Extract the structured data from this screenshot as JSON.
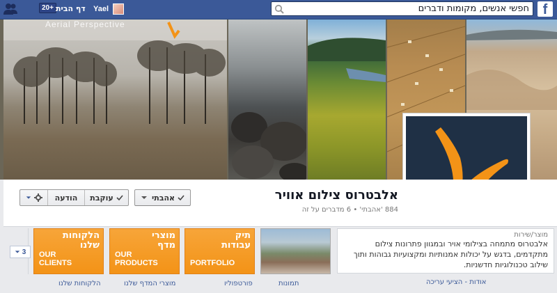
{
  "topbar": {
    "search_placeholder": "חפשי אנשים, מקומות ודברים",
    "user_name": "Yael",
    "home_label": "דף הבית",
    "notif_count": "20+"
  },
  "cover": {
    "watermark": "Aerial Perspective"
  },
  "page": {
    "title": "אלבטרוס צילום אוויר",
    "likes_line": "884 'אהבתי' • 6 מדברים על זה"
  },
  "buttons": {
    "like": "אהבתי",
    "following": "עוקבת",
    "message": "הודעה"
  },
  "about": {
    "category": "מוצר/שירות",
    "text": "אלבטרוס מתמחה בצילומי אויר ובמגוון פתרונות צילום מתקדמים, בדגש על יכולות אמנותיות ומקצועיות גבוהות ותוך שילוב טכנולוגיות חדשניות.",
    "links": "אודות - הציעי עריכה"
  },
  "tiles": {
    "photos_label": "תמונות",
    "portfolio_heb": "תיק עבודות",
    "portfolio_eng": "PORTFOLIO",
    "portfolio_label": "פורטפוליו",
    "products_heb": "מוצרי מדף",
    "products_eng": "OUR PRODUCTS",
    "products_label": "מוצרי המדף שלנו",
    "clients_heb": "הלקוחות שלנו",
    "clients_eng": "OUR CLIENTS",
    "clients_label": "הלקוחות שלנו",
    "more_count": "3"
  },
  "colors": {
    "fb_blue": "#3b5998",
    "tile_orange": "#f39317"
  }
}
